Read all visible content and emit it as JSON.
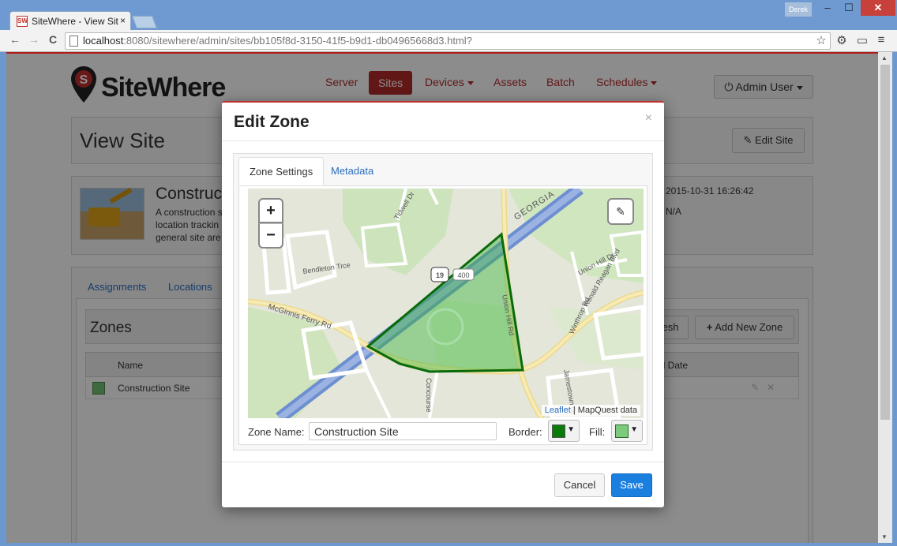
{
  "browser": {
    "tab_title": "SiteWhere - View Sit",
    "tab_favicon": "SW",
    "tab_close": "×",
    "profile_name": "Derek",
    "min": "–",
    "max": "☐",
    "close": "✕",
    "back": "←",
    "forward": "→",
    "reload": "C",
    "url_host": "localhost",
    "url_path": ":8080/sitewhere/admin/sites/bb105f8d-3150-41f5-b9d1-db04965668d3.html?",
    "star": "☆",
    "settings": "⚙",
    "cast": "▭",
    "menu": "≡"
  },
  "app": {
    "logo_text": "SiteWhere",
    "nav": {
      "server": "Server",
      "sites": "Sites",
      "devices": "Devices",
      "assets": "Assets",
      "batch": "Batch",
      "schedules": "Schedules"
    },
    "admin_label": "Admin User",
    "power_icon": "⏻"
  },
  "view_site": {
    "title": "View Site",
    "edit_site_label": "Edit Site",
    "edit_icon": "✎",
    "site_name_partial": "Construc",
    "desc_lines": [
      "A construction s",
      "location trackin",
      "general site are"
    ],
    "created_value": "2015-10-31 16:26:42",
    "updated_value": "N/A",
    "tabs": {
      "assignments": "Assignments",
      "locations": "Locations"
    }
  },
  "zones": {
    "title": "Zones",
    "refresh_label": "esh",
    "add_label": "Add New Zone",
    "plus": "+",
    "col_name": "Name",
    "col_created": "ed Date",
    "rows": [
      {
        "name": "Construction Site"
      }
    ],
    "row_edit": "✎",
    "row_delete": "✕"
  },
  "modal": {
    "title": "Edit Zone",
    "close": "×",
    "tab_settings": "Zone Settings",
    "tab_metadata": "Metadata",
    "zoom_in": "+",
    "zoom_out": "−",
    "draw_icon": "✎",
    "attrib_link": "Leaflet",
    "attrib_rest": " | MapQuest data",
    "zone_name_label": "Zone Name:",
    "zone_name_value": "Construction Site",
    "border_label": "Border:",
    "fill_label": "Fill:",
    "border_color": "#0a7a0a",
    "fill_color": "#7ccb7c",
    "dropdown_arrow": "▼",
    "cancel_label": "Cancel",
    "save_label": "Save"
  },
  "map": {
    "labels": {
      "tidwell": "Tidwell Dr",
      "bendleton": "Bendleton Trce",
      "georgia": "GEORGIA",
      "route19": "19",
      "route400": "400",
      "mcginnis": "McGinnis Ferry Rd",
      "unionhill": "Union Hill Dr",
      "reagan": "Ronald Reagan Blvd",
      "unionhill2": "Union Hill Rd",
      "winthrop": "Winthrop Rd",
      "jamestown": "Jamestown Dr",
      "concourse": "Concourse"
    }
  }
}
